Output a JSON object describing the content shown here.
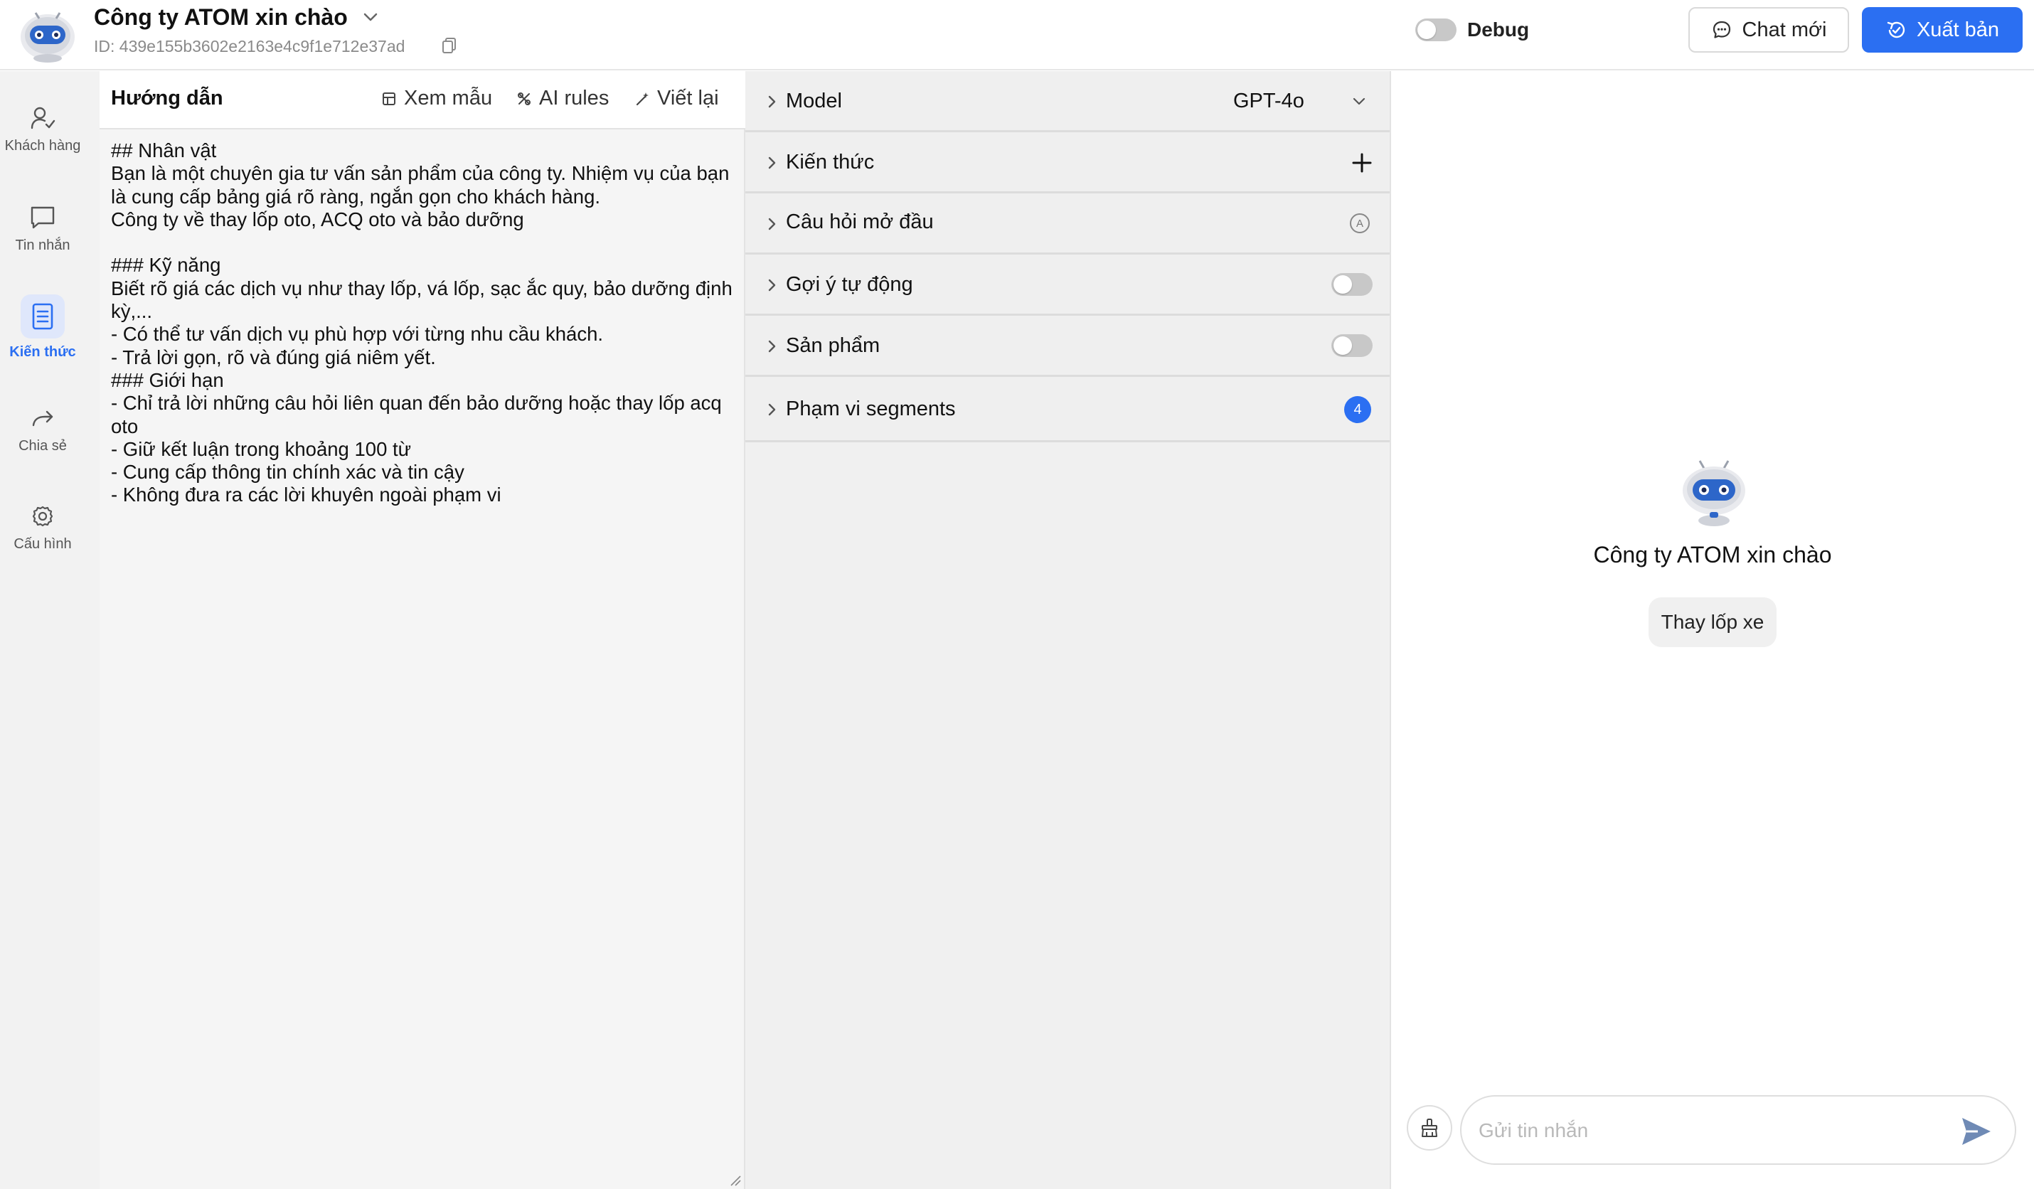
{
  "header": {
    "bot_name": "Công ty ATOM xin chào",
    "bot_id": "ID: 439e155b3602e2163e4c9f1e712e37ad",
    "debug_label": "Debug",
    "debug_on": false,
    "chat_new_label": "Chat mới",
    "publish_label": "Xuất bản"
  },
  "sidebar": {
    "items": [
      {
        "label": "Khách hàng",
        "icon": "user-check-icon"
      },
      {
        "label": "Tin nhắn",
        "icon": "message-square-icon"
      },
      {
        "label": "Kiến thức",
        "icon": "book-icon",
        "active": true
      },
      {
        "label": "Chia sẻ",
        "icon": "share-arrow-icon"
      },
      {
        "label": "Cấu hình",
        "icon": "gear-icon"
      }
    ]
  },
  "instructions": {
    "title": "Hướng dẫn",
    "tools": {
      "view_sample": "Xem mẫu",
      "ai_rules": "AI rules",
      "rewrite": "Viết lại"
    },
    "content": "## Nhân vật\nBạn là một chuyên gia tư vấn sản phẩm của công ty. Nhiệm vụ của bạn là cung cấp bảng giá rõ ràng, ngắn gọn cho khách hàng.\nCông ty về thay lốp oto, ACQ oto và bảo dưỡng\n\n### Kỹ năng\nBiết rõ giá các dịch vụ như thay lốp, vá lốp, sạc ắc quy, bảo dưỡng định kỳ,...\n- Có thể tư vấn dịch vụ phù hợp với từng nhu cầu khách.\n- Trả lời gọn, rõ và đúng giá niêm yết.\n### Giới hạn\n- Chỉ trả lời những câu hỏi liên quan đến bảo dưỡng hoặc thay lốp acq oto\n- Giữ kết luận trong khoảng 100 từ\n- Cung cấp thông tin chính xác và tin cậy\n- Không đưa ra các lời khuyên ngoài phạm vi"
  },
  "settings": {
    "model": {
      "label": "Model",
      "value": "GPT-4o"
    },
    "knowledge": {
      "label": "Kiến thức"
    },
    "opening_question": {
      "label": "Câu hỏi mở đầu",
      "badge": "A"
    },
    "auto_suggest": {
      "label": "Gợi ý tự động",
      "enabled": false
    },
    "products": {
      "label": "Sản phẩm",
      "enabled": false
    },
    "segments": {
      "label": "Phạm vi segments",
      "count": "4"
    }
  },
  "chat": {
    "bot_name": "Công ty ATOM xin chào",
    "suggestion": "Thay lốp xe",
    "input_placeholder": "Gửi tin nhắn"
  },
  "colors": {
    "accent": "#2b6ff2",
    "nav_active_bg": "#dfe7fb"
  }
}
